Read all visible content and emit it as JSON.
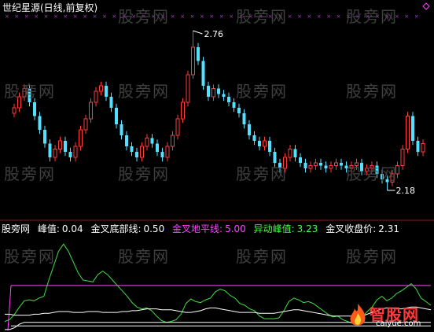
{
  "header": {
    "title": "世纪星源(日线,前复权)"
  },
  "watermark": "股旁网",
  "logo": {
    "brand": "智股网",
    "url": "caiyue.com"
  },
  "indicator_bar": {
    "source": "股旁网",
    "items": [
      {
        "label": "峰值:",
        "value": "0.04",
        "color": "#ffffff"
      },
      {
        "label": "金叉底部线:",
        "value": "0.50",
        "color": "#ffffff"
      },
      {
        "label": "金叉地平线:",
        "value": "5.00",
        "color": "#ff44ff"
      },
      {
        "label": "异动峰值:",
        "value": "3.23",
        "color": "#44ff44"
      },
      {
        "label": "金叉收盘价:",
        "value": "2.31",
        "color": "#ffffff"
      }
    ]
  },
  "colors": {
    "up": "#ff3b3b",
    "down": "#54e0ff",
    "level": "#ff44ff",
    "osc": "#3fe03f",
    "base": "#ffffff"
  },
  "chart_data": [
    {
      "type": "candlestick",
      "title": "世纪星源(日线,前复权)",
      "annotations": [
        {
          "label": "2.76",
          "kind": "high"
        },
        {
          "label": "2.18",
          "kind": "low"
        }
      ],
      "ylim": [
        2.1,
        2.8
      ],
      "series": [
        {
          "values": [
            2.48,
            2.52,
            2.55,
            2.5,
            2.45,
            2.4,
            2.35,
            2.3,
            2.33,
            2.36,
            2.32,
            2.3,
            2.34,
            2.4,
            2.44,
            2.5,
            2.54,
            2.56,
            2.52,
            2.48,
            2.42,
            2.38,
            2.34,
            2.32,
            2.3,
            2.34,
            2.37,
            2.35,
            2.32,
            2.3,
            2.34,
            2.38,
            2.44,
            2.5,
            2.6,
            2.7,
            2.65,
            2.56,
            2.52,
            2.55,
            2.53,
            2.52,
            2.5,
            2.48,
            2.46,
            2.42,
            2.38,
            2.36,
            2.34,
            2.36,
            2.32,
            2.28,
            2.26,
            2.3,
            2.33,
            2.3,
            2.28,
            2.26,
            2.27,
            2.28,
            2.27,
            2.26,
            2.27,
            2.28,
            2.27,
            2.26,
            2.27,
            2.28,
            2.25,
            2.26,
            2.27,
            2.24,
            2.22,
            2.21,
            2.24,
            2.27,
            2.33,
            2.45,
            2.36,
            2.32,
            2.35
          ]
        }
      ]
    },
    {
      "type": "line",
      "series": [
        {
          "name": "金叉地平线",
          "values": [
            5.0,
            5.0
          ]
        },
        {
          "name": "金叉底部线",
          "values": [
            0.5,
            0.5
          ]
        },
        {
          "values": [
            1.0,
            1.2,
            1.8,
            2.6,
            3.3,
            3.4,
            3.3,
            3.6,
            3.8,
            5.6,
            7.2,
            8.8,
            9.6,
            8.8,
            7.6,
            6.4,
            5.6,
            5.5,
            5.4,
            6.2,
            6.6,
            6.2,
            5.6,
            5.0,
            4.4,
            3.8,
            3.1,
            2.6,
            2.4,
            2.5,
            2.2,
            1.6,
            1.1,
            0.9,
            1.0,
            1.2,
            1.8,
            3.0,
            3.5,
            3.2,
            3.1,
            3.4,
            3.6,
            4.3,
            4.6,
            4.4,
            3.9,
            3.6,
            3.0,
            2.8,
            2.4,
            2.2,
            1.6,
            1.3,
            1.3,
            1.3,
            1.4,
            2.2,
            3.2,
            3.6,
            3.4,
            3.1,
            3.2,
            3.0,
            2.6,
            2.2,
            1.8,
            1.5,
            1.6,
            1.2,
            1.0,
            0.8,
            1.1,
            1.5,
            2.1,
            2.6,
            3.4,
            3.8,
            3.3,
            3.6,
            4.1,
            4.4,
            4.8,
            5.2,
            4.6,
            3.6,
            3.2,
            2.8
          ]
        },
        {
          "values": [
            1.8,
            1.8,
            1.7,
            1.7,
            1.7,
            1.7,
            1.8,
            1.8,
            1.9,
            1.9,
            2.0,
            2.1,
            2.1,
            2.1,
            2.0,
            2.0,
            2.0,
            2.1,
            2.1,
            2.1,
            2.0,
            2.0,
            2.0,
            2.0,
            2.1,
            2.1,
            2.2,
            2.2,
            2.3,
            2.4,
            2.4,
            2.4,
            2.3,
            2.3,
            2.3,
            2.2,
            2.1,
            2.0,
            2.0,
            2.1,
            2.2,
            2.4,
            2.5,
            2.5,
            2.4,
            2.3,
            2.2,
            2.1,
            2.0,
            2.0,
            2.0,
            2.0,
            1.9,
            1.9,
            1.9,
            1.9,
            2.0,
            2.1,
            2.2,
            2.3,
            2.3,
            2.2,
            2.1,
            2.0,
            1.9,
            1.8,
            1.7,
            1.6,
            1.6,
            1.6,
            1.6,
            1.6,
            1.6,
            1.6,
            1.8,
            2.0,
            2.2,
            2.4,
            2.5,
            2.5,
            2.4,
            2.4,
            2.5,
            2.6,
            2.6,
            2.5,
            2.4,
            2.3
          ]
        },
        {
          "values": [
            0.1,
            0.1,
            0.3,
            0.7,
            0.9,
            0.9,
            0.9,
            0.9,
            0.9,
            0.9,
            0.9,
            0.9,
            0.9,
            0.9,
            0.9,
            0.9,
            0.9,
            0.9,
            0.9,
            0.9,
            0.9,
            0.9,
            0.9,
            0.9,
            0.9,
            0.9,
            0.9,
            0.9,
            0.9,
            0.9,
            0.9,
            0.9,
            0.9,
            0.9,
            0.9,
            0.9,
            0.9,
            0.9,
            0.9,
            0.9,
            0.9,
            0.9,
            0.9,
            0.9,
            0.9,
            0.9,
            0.9,
            0.9,
            0.9,
            0.9,
            0.9,
            0.9,
            0.9,
            0.9,
            0.9,
            0.9,
            0.9,
            0.9,
            0.9,
            0.9,
            0.9,
            0.9,
            0.9,
            0.9,
            0.9,
            0.9,
            0.9,
            0.9,
            0.9,
            0.9,
            0.9,
            0.9,
            0.9,
            0.9,
            0.9,
            0.9,
            0.9,
            0.9,
            0.9,
            0.9,
            0.9,
            0.9,
            0.9,
            0.9,
            0.9,
            0.9,
            0.9,
            0.9
          ]
        }
      ],
      "ylim": [
        0,
        10.5
      ]
    }
  ]
}
